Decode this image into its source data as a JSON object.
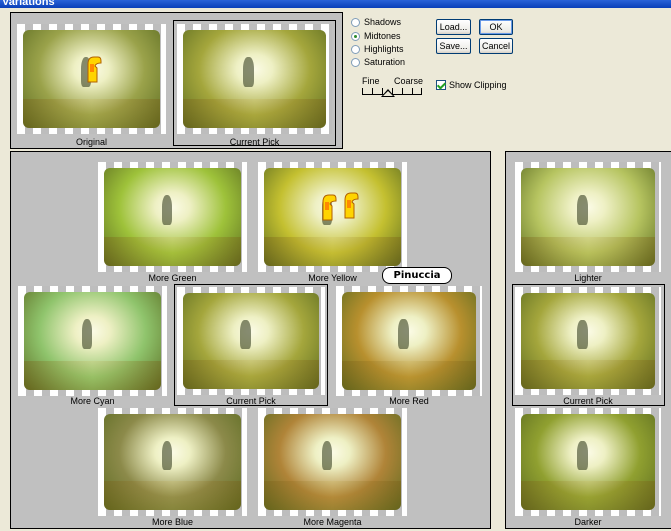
{
  "window": {
    "title": "Variations"
  },
  "tone_options": [
    {
      "label": "Shadows",
      "selected": false
    },
    {
      "label": "Midtones",
      "selected": true
    },
    {
      "label": "Highlights",
      "selected": false
    },
    {
      "label": "Saturation",
      "selected": false
    }
  ],
  "buttons": {
    "load": "Load...",
    "ok": "OK",
    "save": "Save...",
    "cancel": "Cancel"
  },
  "slider": {
    "fine": "Fine",
    "coarse": "Coarse"
  },
  "show_clipping": {
    "label": "Show Clipping",
    "checked": true
  },
  "top_thumbs": {
    "original": "Original",
    "current_pick": "Current Pick"
  },
  "color_thumbs": {
    "more_green": "More Green",
    "more_yellow": "More Yellow",
    "more_cyan": "More Cyan",
    "current_pick": "Current Pick",
    "more_red": "More Red",
    "more_blue": "More Blue",
    "more_magenta": "More Magenta"
  },
  "brightness_thumbs": {
    "lighter": "Lighter",
    "current_pick": "Current Pick",
    "darker": "Darker"
  },
  "watermark": "Pinuccia",
  "tints": {
    "original": "#9aa24a",
    "pick": "#a4a63c",
    "green": "#9ec23a",
    "yellow": "#c4c030",
    "cyan": "#8fc46c",
    "red": "#b8902e",
    "blue": "#8c8a4a",
    "magenta": "#b08438",
    "lighter": "#b6c460",
    "darker": "#90a030"
  }
}
